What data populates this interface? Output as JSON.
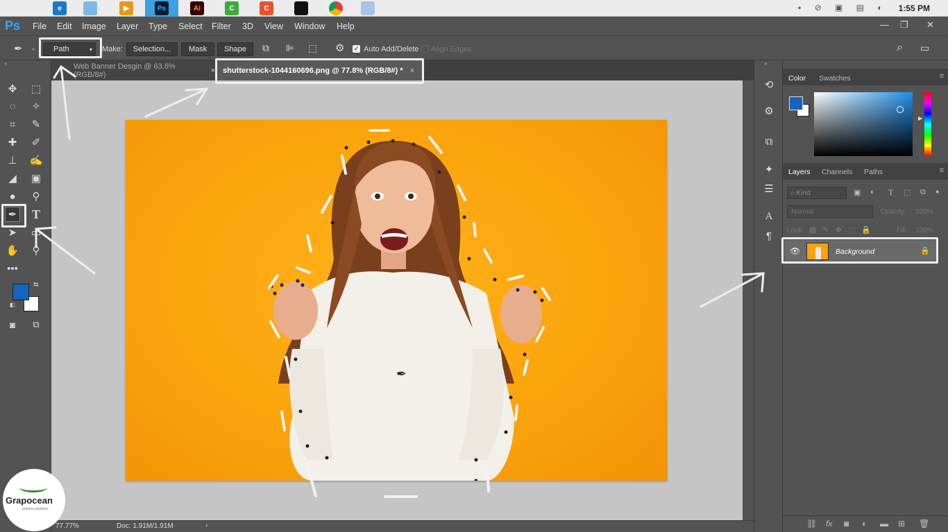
{
  "taskbar": {
    "time": "1:55 PM",
    "apps": [
      {
        "icon": "apple-icon",
        "label": ""
      },
      {
        "icon": "edge-icon",
        "label": "e"
      },
      {
        "icon": "folder-icon",
        "label": ""
      },
      {
        "icon": "media-player-icon",
        "label": "▶"
      },
      {
        "icon": "photoshop-app-icon",
        "label": "Ps"
      },
      {
        "icon": "illustrator-app-icon",
        "label": "Ai"
      },
      {
        "icon": "camtasia-icon",
        "label": "C"
      },
      {
        "icon": "recorder-icon",
        "label": "C"
      },
      {
        "icon": "media-app-icon",
        "label": ""
      },
      {
        "icon": "chrome-icon",
        "label": ""
      },
      {
        "icon": "installer-icon",
        "label": ""
      }
    ]
  },
  "app": {
    "logo": "Ps",
    "menu": [
      "File",
      "Edit",
      "Image",
      "Layer",
      "Type",
      "Select",
      "Filter",
      "3D",
      "View",
      "Window",
      "Help"
    ],
    "window_controls": [
      "—",
      "❐",
      "✕"
    ]
  },
  "options": {
    "mode_value": "Path",
    "make_label": "Make:",
    "selection_btn": "Selection...",
    "mask_btn": "Mask",
    "shape_btn": "Shape",
    "auto_add_delete": "Auto Add/Delete",
    "align_edges": "Align Edges"
  },
  "tabs": [
    {
      "label": "Web Banner Desgin @ 63.6% (RGB/8#)",
      "close": "×"
    },
    {
      "label": "shutterstock-1044160696.png @ 77.8% (RGB/8#) *",
      "close": "×"
    }
  ],
  "status": {
    "zoom": "77.77%",
    "doc": "Doc: 1.91M/1.91M",
    "arrow": "›"
  },
  "colors": {
    "foreground": "#1565c0",
    "background": "#ffffff",
    "ps_blue": "#31a8ff",
    "highlight": "#eeeeee"
  },
  "panels": {
    "color_tabs": [
      "Color",
      "Swatches"
    ],
    "layers_tabs": [
      "Layers",
      "Channels",
      "Paths"
    ],
    "kind_placeholder": "Kind",
    "blend_mode": "Normal",
    "opacity_label": "Opacity:",
    "opacity_value": "100%",
    "lock_label": "Lock:",
    "fill_label": "Fill:",
    "fill_value": "100%",
    "layer_name": "Background"
  },
  "watermark": {
    "brand": "Grapocean",
    "tagline": "graphic solutions"
  }
}
